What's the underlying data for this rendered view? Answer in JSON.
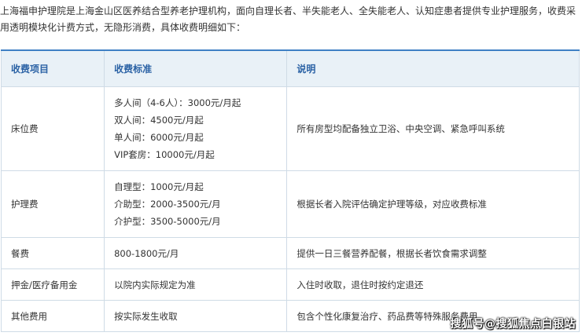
{
  "intro": "上海福申护理院是上海金山区医养结合型养老护理机构，面向自理长者、半失能老人、全失能老人、认知症患者提供专业护理服务，收费采用透明模块化计费方式，无隐形消费，具体收费明细如下：",
  "table": {
    "headers": [
      "收费项目",
      "收费标准",
      "说明"
    ],
    "rows": [
      {
        "item": "床位费",
        "standard": [
          "多人间（4-6人）：3000元/月起",
          "双人间：4500元/月起",
          "单人间：6000元/月起",
          "VIP套房：10000元/月起"
        ],
        "note": "所有房型均配备独立卫浴、中央空调、紧急呼叫系统"
      },
      {
        "item": "护理费",
        "standard": [
          "自理型：1000元/月起",
          "介助型：2000-3500元/月",
          "介护型：3500-5000元/月"
        ],
        "note": "根据长者入院评估确定护理等级，对应收费标准"
      },
      {
        "item": "餐费",
        "standard": [
          "800-1800元/月"
        ],
        "note": "提供一日三餐营养配餐，根据长者饮食需求调整"
      },
      {
        "item": "押金/医疗备用金",
        "standard": [
          "以院内实际规定为准"
        ],
        "note": "入住时收取，退住时按约定退还"
      },
      {
        "item": "其他费用",
        "standard": [
          "按实际发生收取"
        ],
        "note": "包含个性化康复治疗、药品费等特殊服务费用"
      }
    ]
  },
  "watermark": "搜狐号@搜狐焦点白银站"
}
